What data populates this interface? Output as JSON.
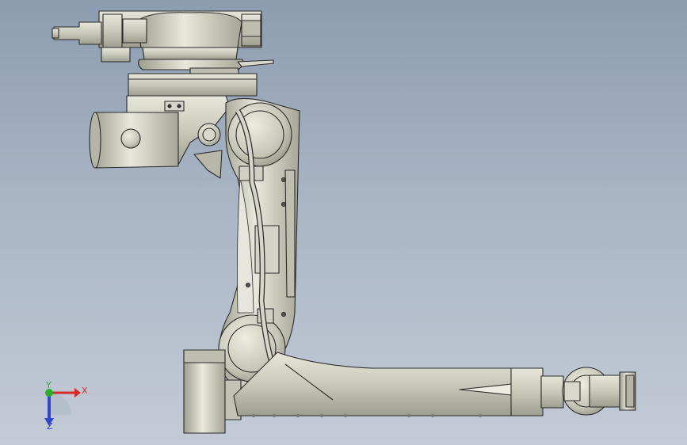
{
  "view": {
    "background_top": "#8d9cb0",
    "background_bottom": "#c3cbd6"
  },
  "model": {
    "body_color": "#c9c9bb",
    "shade_color": "#a9a99a",
    "edge_color": "#2a2a2a"
  },
  "triad": {
    "x_label": "X",
    "y_label": "Y",
    "z_label": "Z",
    "x_color": "#d42a2a",
    "y_color": "#2ab02a",
    "z_color": "#3048c8"
  }
}
